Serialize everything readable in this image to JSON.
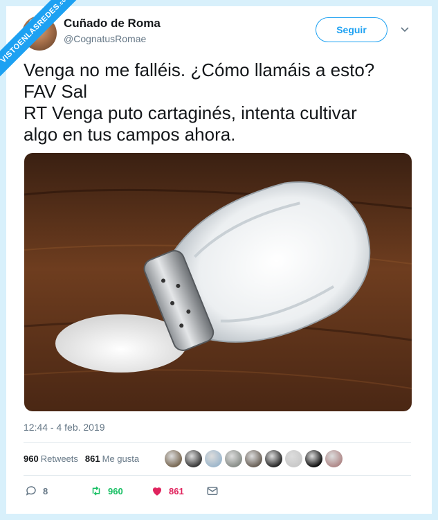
{
  "watermark": {
    "text": "VISTOENLASREDES",
    "suffix": ".com"
  },
  "author": {
    "name": "Cuñado de Roma",
    "handle": "@CognatusRomae",
    "avatar_icon": "user-avatar"
  },
  "follow_label": "Seguir",
  "tweet_lines": [
    "Venga no me falléis. ¿Cómo llamáis a esto?",
    "FAV Sal",
    "RT Venga puto cartaginés, intenta cultivar",
    "algo en tus campos ahora."
  ],
  "photo": {
    "alt_icon": "salt-shaker-photo"
  },
  "timestamp": "12:44 - 4 feb. 2019",
  "stats": {
    "retweets_count": "960",
    "retweets_label": "Retweets",
    "likes_count": "861",
    "likes_label": "Me gusta"
  },
  "likers_avatars": [
    "#7a6a55",
    "#3b3b3b",
    "#9fb8cc",
    "#8a8f8a",
    "#6b6259",
    "#2a2a2a",
    "#c9c9c9",
    "#111111",
    "#b08a8a"
  ],
  "actions": {
    "reply_count": "8",
    "retweet_count": "960",
    "like_count": "861"
  },
  "colors": {
    "accent": "#1da1f2",
    "retweet": "#17bf63",
    "like": "#e0245e",
    "muted": "#657786"
  }
}
